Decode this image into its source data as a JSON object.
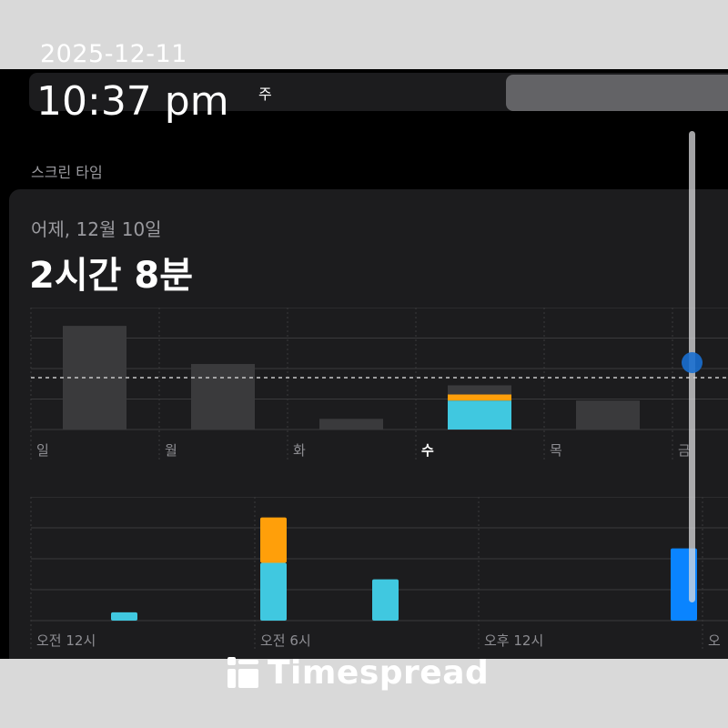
{
  "overlay": {
    "date": "2025-12-11",
    "time": "10:37 pm",
    "watermark": "Timespread"
  },
  "segmented": {
    "week_label": "주",
    "day_label": ""
  },
  "section_title": "스크린 타임",
  "card": {
    "date_label": "어제, 12월 10일",
    "total": "2시간 8분"
  },
  "colors": {
    "bar_gray": "#3a3a3c",
    "cyan": "#40c8e0",
    "orange": "#ff9f0a",
    "blue": "#0a84ff",
    "scrubber": "#1a6fd0"
  },
  "chart_data": [
    {
      "type": "bar",
      "categories": [
        "일",
        "월",
        "화",
        "수",
        "목",
        "금"
      ],
      "selected_category": "수",
      "values": [
        3.4,
        2.15,
        0.35,
        1.45,
        0.95,
        null
      ],
      "selected_breakdown": [
        {
          "color": "cyan",
          "value": 0.95
        },
        {
          "color": "orange",
          "value": 0.2
        },
        {
          "color": "gray",
          "value": 0.3
        }
      ],
      "average": 1.7,
      "ylim": [
        0,
        4
      ],
      "grid": true
    },
    {
      "type": "bar",
      "tick_labels": [
        "오전 12시",
        "오전 6시",
        "오후 12시",
        "오"
      ],
      "bars": [
        {
          "hour": 2,
          "cyan": 4,
          "orange": 0
        },
        {
          "hour": 6,
          "cyan": 28,
          "orange": 22
        },
        {
          "hour": 9,
          "cyan": 20,
          "orange": 0
        },
        {
          "hour": 17,
          "blue": 35
        }
      ],
      "ylim": [
        0,
        60
      ],
      "grid": true
    }
  ]
}
